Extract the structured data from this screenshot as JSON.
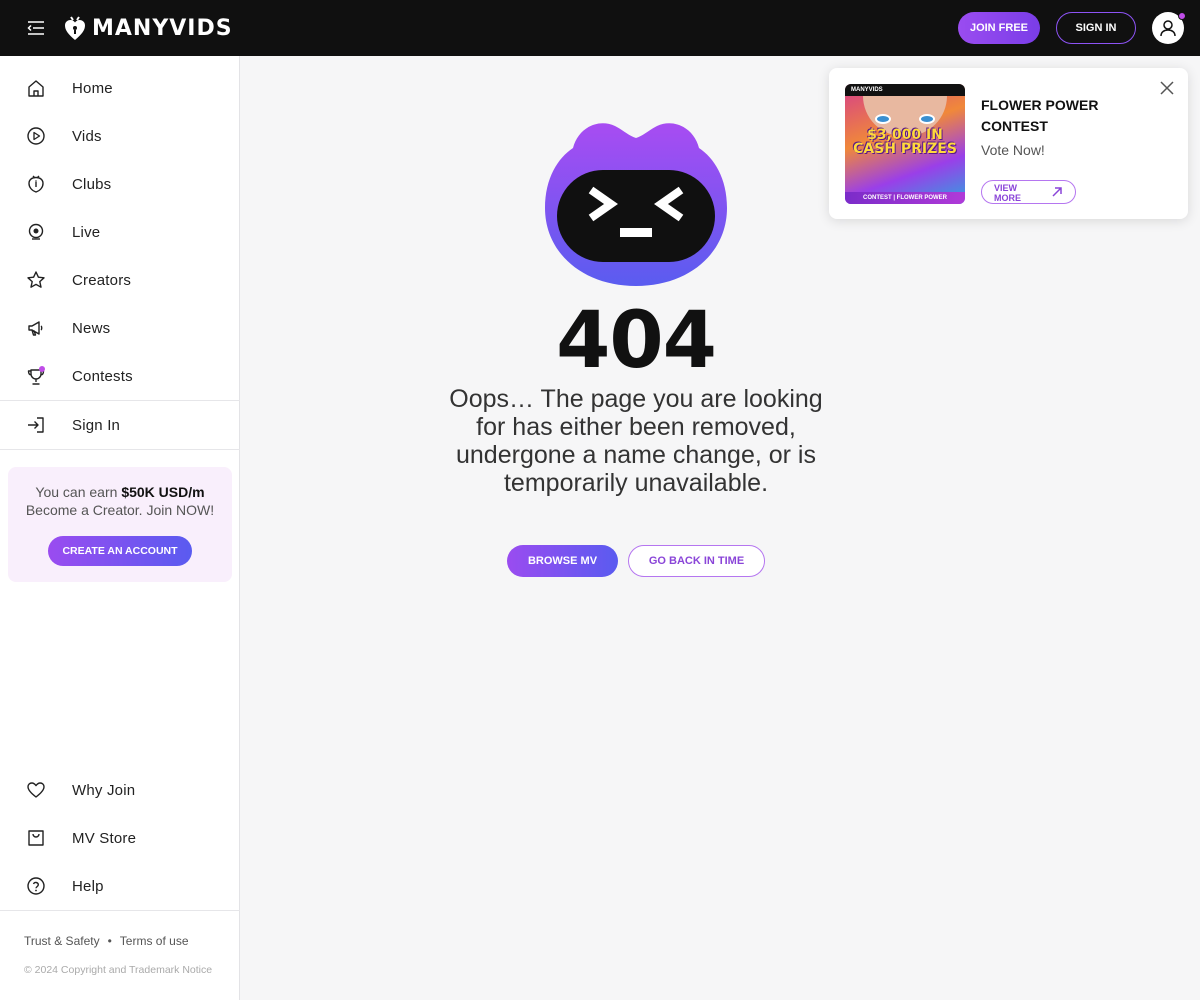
{
  "header": {
    "logo_text": "MANYVIDS",
    "join_label": "JOIN FREE",
    "signin_label": "SIGN IN"
  },
  "sidebar": {
    "items": [
      {
        "label": "Home",
        "icon": "home-icon"
      },
      {
        "label": "Vids",
        "icon": "play-icon"
      },
      {
        "label": "Clubs",
        "icon": "clubs-icon"
      },
      {
        "label": "Live",
        "icon": "webcam-icon"
      },
      {
        "label": "Creators",
        "icon": "star-icon"
      },
      {
        "label": "News",
        "icon": "megaphone-icon"
      },
      {
        "label": "Contests",
        "icon": "trophy-icon"
      }
    ],
    "signin_label": "Sign In",
    "promo": {
      "line1_prefix": "You can earn",
      "line1_bold": "$50K USD/m",
      "line2": "Become a Creator. Join NOW!",
      "button": "CREATE AN ACCOUNT"
    },
    "bottom_items": [
      {
        "label": "Why Join",
        "icon": "heart-icon"
      },
      {
        "label": "MV Store",
        "icon": "shopping-bag-icon"
      },
      {
        "label": "Help",
        "icon": "help-icon"
      }
    ],
    "footer": {
      "trust": "Trust & Safety",
      "separator": "•",
      "terms": "Terms of use",
      "copyright": "© 2024 Copyright and Trademark Notice"
    }
  },
  "main": {
    "code": "404",
    "message": "Oops… The page you are looking for has either been removed, undergone a name change, or is temporarily unavailable.",
    "browse_label": "BROWSE MV",
    "back_label": "GO BACK IN TIME"
  },
  "popup": {
    "title": "FLOWER POWER CONTEST",
    "subtitle": "Vote Now!",
    "button": "VIEW MORE",
    "thumb_logo": "MANYVIDS",
    "thumb_prize": "$3,000 IN CASH PRIZES",
    "thumb_bottom": "CONTEST | FLOWER POWER"
  },
  "colors": {
    "accent": "#8d53f5",
    "header_bg": "#101010",
    "page_bg": "#f6f6f7"
  }
}
